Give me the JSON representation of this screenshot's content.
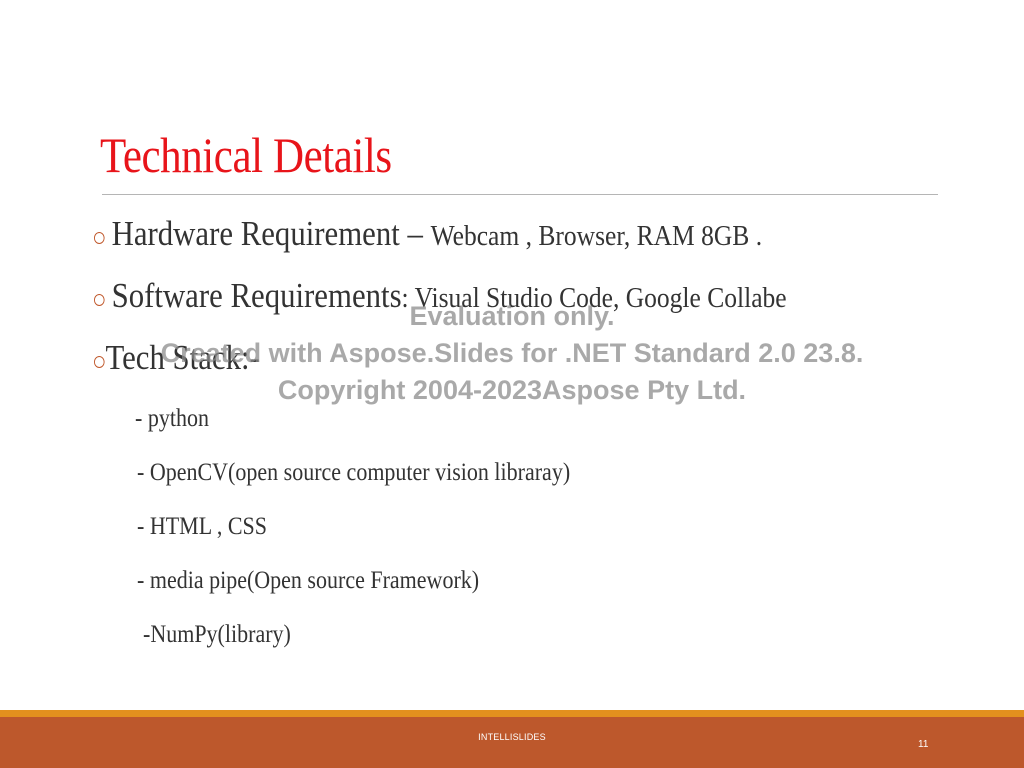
{
  "slide": {
    "title": "Technical Details",
    "bullets": [
      {
        "heading": "Hardware Requirement",
        "separator": " – ",
        "detail": "Webcam , Browser, RAM 8GB ."
      },
      {
        "heading": "Software Requirements",
        "separator": ": ",
        "detail": "Visual Studio Code, Google Collabe"
      },
      {
        "heading": "Tech Stack:-"
      }
    ],
    "tech_stack": [
      "- python",
      "- OpenCV(open source computer vision libraray)",
      "- HTML , CSS",
      "- media pipe(Open source Framework)",
      "-NumPy(library)"
    ]
  },
  "watermark": {
    "line1": "Evaluation only.",
    "line2": "Created with Aspose.Slides for .NET Standard 2.0 23.8.",
    "line3": "Copyright 2004-2023Aspose Pty Ltd."
  },
  "footer": {
    "text": "INTELLISLIDES",
    "page_number": "11"
  },
  "colors": {
    "title": "#e8141a",
    "bullet_marker": "#c0582b",
    "footer_bar": "#bd582c",
    "footer_stripe": "#e3901e"
  }
}
